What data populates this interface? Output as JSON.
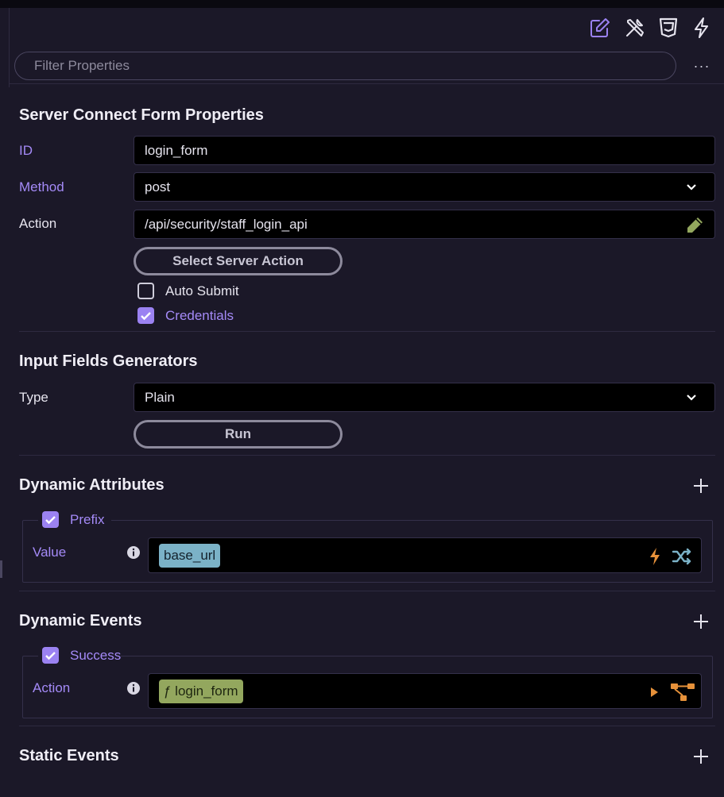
{
  "toolbar": {
    "icons": [
      "edit-icon",
      "tools-icon",
      "css3-icon",
      "lightning-icon"
    ],
    "accent": "#9b82f2"
  },
  "filter": {
    "placeholder": "Filter Properties",
    "more_label": "···"
  },
  "form_section": {
    "title": "Server Connect Form Properties",
    "id": {
      "label": "ID",
      "value": "login_form"
    },
    "method": {
      "label": "Method",
      "value": "post"
    },
    "action": {
      "label": "Action",
      "value": "/api/security/staff_login_api"
    },
    "select_button": "Select Server Action",
    "auto_submit": {
      "label": "Auto Submit",
      "checked": false
    },
    "credentials": {
      "label": "Credentials",
      "checked": true
    }
  },
  "generators": {
    "title": "Input Fields Generators",
    "type": {
      "label": "Type",
      "value": "Plain"
    },
    "run_button": "Run"
  },
  "dynamic_attributes": {
    "title": "Dynamic Attributes",
    "group": {
      "label": "Prefix",
      "checked": true
    },
    "value": {
      "label": "Value",
      "token": "base_url",
      "token_color": "#7bb2c7"
    }
  },
  "dynamic_events": {
    "title": "Dynamic Events",
    "group": {
      "label": "Success",
      "checked": true
    },
    "action": {
      "label": "Action",
      "token": "ƒ login_form",
      "token_color": "#93a75e"
    }
  },
  "static_events": {
    "title": "Static Events"
  }
}
